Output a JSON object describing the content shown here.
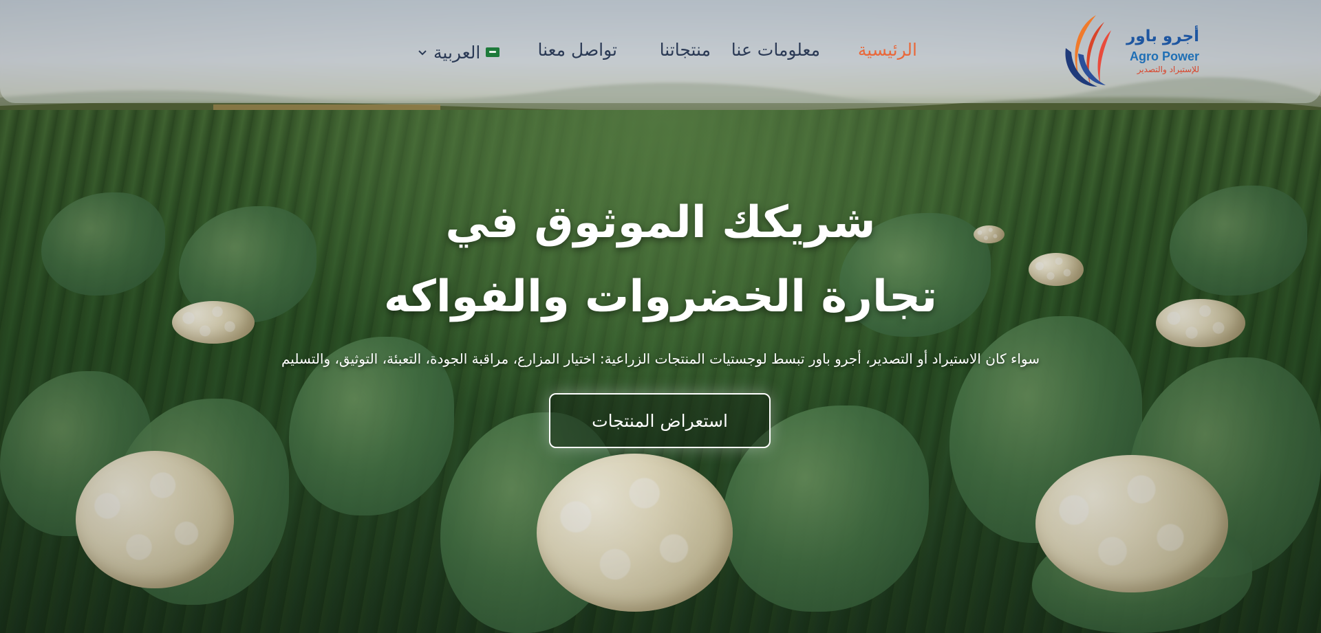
{
  "brand": {
    "name_ar": "أجرو باور",
    "name_en": "Agro Power",
    "tagline_ar": "للإستيراد والتصدير",
    "colors": {
      "blue": "#1e56a0",
      "red": "#d9452b",
      "orange": "#f07a2b"
    }
  },
  "nav": {
    "items": [
      {
        "label": "الرئيسية",
        "active": true
      },
      {
        "label": "معلومات عنا",
        "active": false
      },
      {
        "label": "منتجاتنا",
        "active": false
      },
      {
        "label": "تواصل معنا",
        "active": false
      }
    ],
    "language": {
      "label": "العربية",
      "flag_icon": "saudi-flag-icon"
    },
    "active_color": "#e9683a",
    "text_color": "#2b3a55"
  },
  "hero": {
    "headline_line1": "شريكك الموثوق في",
    "headline_line2": "تجارة الخضروات والفواكه",
    "subtitle": "سواء كان الاستيراد أو التصدير، أجرو باور تبسط لوجستيات المنتجات الزراعية: اختيار المزارع، مراقبة الجودة، التعبئة، التوثيق، والتسليم",
    "cta_label": "استعراض المنتجات"
  }
}
